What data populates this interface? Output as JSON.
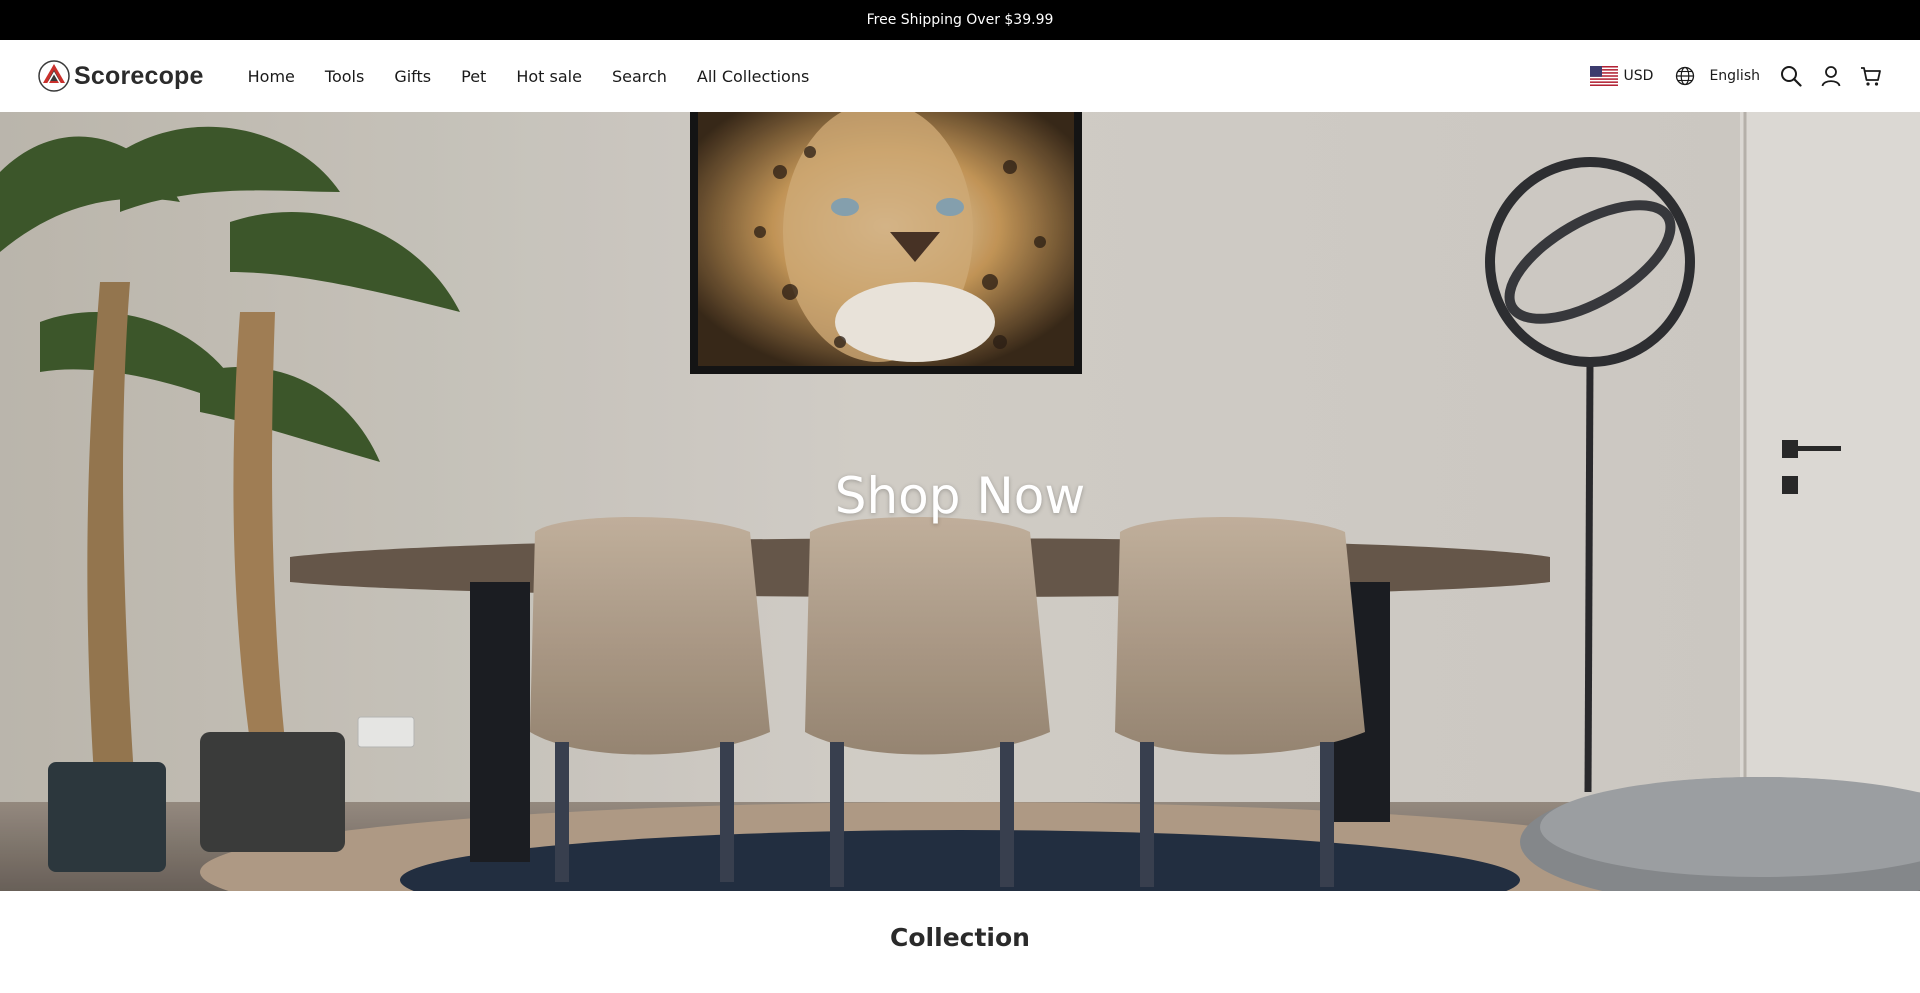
{
  "announcement": {
    "text": "Free Shipping Over $39.99"
  },
  "header": {
    "logo_text": "Scorecope",
    "nav": [
      {
        "label": "Home"
      },
      {
        "label": "Tools"
      },
      {
        "label": "Gifts"
      },
      {
        "label": "Pet"
      },
      {
        "label": "Hot sale"
      },
      {
        "label": "Search"
      },
      {
        "label": "All Collections"
      }
    ],
    "currency": "USD",
    "language": "English",
    "icons": [
      "globe-icon",
      "search-icon",
      "account-icon",
      "cart-icon"
    ]
  },
  "hero": {
    "cta_label": "Shop Now"
  },
  "section": {
    "title": "Collection"
  },
  "colors": {
    "announcement_bg": "#000000",
    "text": "#1a1a1a",
    "hero_text": "#ffffff"
  }
}
